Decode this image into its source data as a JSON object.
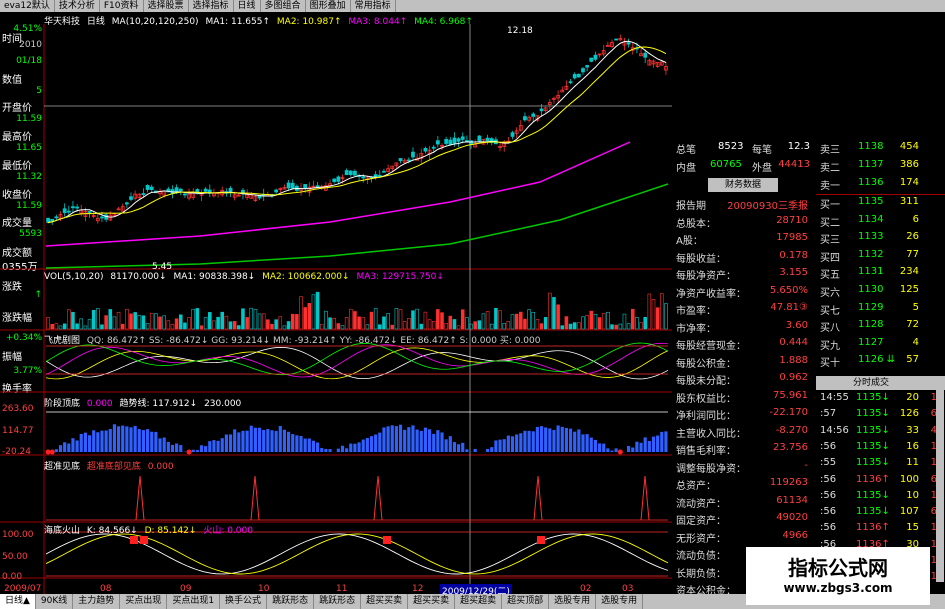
{
  "menu": [
    "eva12默认",
    "技术分析",
    "F10资料",
    "选择股票",
    "选择指标",
    "日线",
    "多图组合",
    "图形叠加",
    "常用指标"
  ],
  "main_header": {
    "stock": "华天科技",
    "period": "日线",
    "ma_params": "MA(10,20,120,250)",
    "ma1": "MA1: 11.655↑",
    "ma2": "MA2: 10.987↑",
    "ma3": "MA3: 8.044↑",
    "ma4": "MA4: 6.968↑",
    "high_mark": "12.18",
    "low_mark": "5.45"
  },
  "left_panel": {
    "labels": [
      "时间",
      "2010",
      "01/18",
      "数值",
      "5",
      "开盘价",
      "11.59",
      "最高价",
      "11.65",
      "最低价",
      "11.32",
      "收盘价",
      "11.59",
      "成交量",
      "5593",
      "成交额",
      "0355万",
      "涨跌",
      "↑",
      "涨跌幅",
      "+0.34%",
      "振幅",
      "3.77%",
      "换手率",
      "4.51%"
    ]
  },
  "vol_header": {
    "title": "VOL(5,10,20)",
    "v1": "81170.000↓",
    "ma1": "MA1: 90838.398↓",
    "ma2": "MA2: 100662.000↓",
    "ma3": "MA3: 129715.750↓"
  },
  "ind1_header": {
    "title": "飞虎剧图",
    "text": "QQ: 86.472↑ SS: -86.472↓ GG: 93.214↓ MM: -93.214↑ YY: -86.472↓ EE: 86.472↑ S: 0.000 买: 0.000"
  },
  "ind2_header": {
    "title": "阶段顶底",
    "v": "0.000",
    "trend": "趋势线: 117.912↓",
    "top": "230.000",
    "scale": [
      "263.60",
      "114.77",
      "-20.24"
    ]
  },
  "ind3_header": {
    "title": "超准见底",
    "sub": "超准底部见底",
    "v": "0.000"
  },
  "ind4_header": {
    "title": "海底火山",
    "k": "K: 84.566↓",
    "d": "D: 85.142↓",
    "huoshan": "火山: 0.000",
    "scale": [
      "100.00",
      "50.00",
      "0.00"
    ]
  },
  "date_axis": {
    "start": "2009/07",
    "labels": [
      "08",
      "09",
      "10",
      "11",
      "12",
      "02",
      "03"
    ],
    "cursor": "2009/12/29(二)"
  },
  "quote_top": [
    {
      "k": "总笔",
      "v": "8523",
      "k2": "每笔",
      "v2": "12.3"
    },
    {
      "k": "内盘",
      "v": "60765",
      "k2": "外盘",
      "v2": "44413"
    }
  ],
  "fin_title": "财务数据",
  "financials": [
    {
      "k": "报告期",
      "v": "20090930三季报"
    },
    {
      "k": "总股本：",
      "v": "28710"
    },
    {
      "k": "A股：",
      "v": "17985"
    },
    {
      "k": "每股收益：",
      "v": "0.178"
    },
    {
      "k": "每股净资产：",
      "v": "3.155"
    },
    {
      "k": "净资产收益率：",
      "v": "5.650%"
    },
    {
      "k": "市盈率：",
      "v": "47.81③"
    },
    {
      "k": "市净率：",
      "v": "3.60"
    },
    {
      "k": "每股经营现金：",
      "v": "0.444"
    },
    {
      "k": "每股公积金：",
      "v": "1.888"
    },
    {
      "k": "每股未分配：",
      "v": "0.962"
    },
    {
      "k": "股东权益比：",
      "v": "75.961"
    },
    {
      "k": "净利润同比：",
      "v": "-22.170"
    },
    {
      "k": "主营收入同比：",
      "v": "-8.270"
    },
    {
      "k": "销售毛利率：",
      "v": "23.756"
    },
    {
      "k": "调整每股净资：",
      "v": "-"
    },
    {
      "k": "总资产：",
      "v": "119263"
    },
    {
      "k": "流动资产：",
      "v": "61134"
    },
    {
      "k": "固定资产：",
      "v": "49020"
    },
    {
      "k": "无形资产：",
      "v": "4966"
    },
    {
      "k": "流动负债：",
      "v": ""
    },
    {
      "k": "长期负债：",
      "v": ""
    },
    {
      "k": "资本公积金：",
      "v": ""
    }
  ],
  "orderbook": [
    {
      "k": "卖三",
      "p": "1138",
      "q": "454"
    },
    {
      "k": "卖二",
      "p": "1137",
      "q": "386"
    },
    {
      "k": "卖一",
      "p": "1136",
      "q": "174"
    },
    {
      "k": "买一",
      "p": "1135",
      "q": "311"
    },
    {
      "k": "买二",
      "p": "1134",
      "q": "6"
    },
    {
      "k": "买三",
      "p": "1133",
      "q": "26"
    },
    {
      "k": "买四",
      "p": "1132",
      "q": "77"
    },
    {
      "k": "买五",
      "p": "1131",
      "q": "234"
    },
    {
      "k": "买六",
      "p": "1130",
      "q": "125"
    },
    {
      "k": "买七",
      "p": "1129",
      "q": "5"
    },
    {
      "k": "买八",
      "p": "1128",
      "q": "72"
    },
    {
      "k": "买九",
      "p": "1127",
      "q": "4"
    },
    {
      "k": "买十",
      "p": "1126 ⇊",
      "q": "57"
    }
  ],
  "trades_title": "分时成交",
  "trades": [
    {
      "t": "14:55",
      "p": "1135↓",
      "v": "20",
      "c": "1"
    },
    {
      "t": ":57",
      "p": "1135↓",
      "v": "126",
      "c": "6"
    },
    {
      "t": "14:56",
      "p": "1135↓",
      "v": "33",
      "c": "4"
    },
    {
      "t": ":56",
      "p": "1135↓",
      "v": "16",
      "c": "1"
    },
    {
      "t": ":55",
      "p": "1135↓",
      "v": "11",
      "c": "1"
    },
    {
      "t": ":56",
      "p": "1136↑",
      "v": "100",
      "c": "6"
    },
    {
      "t": ":56",
      "p": "1135↓",
      "v": "10",
      "c": "1"
    },
    {
      "t": ":56",
      "p": "1135↓",
      "v": "107",
      "c": "6"
    },
    {
      "t": ":56",
      "p": "1136↑",
      "v": "15",
      "c": "1"
    },
    {
      "t": ":56",
      "p": "1136↑",
      "v": "30",
      "c": "1"
    },
    {
      "t": ":56",
      "p": "1136↑",
      "v": "30",
      "c": "1"
    },
    {
      "t": ":56",
      "p": "1136↑",
      "v": "30",
      "c": "1"
    }
  ],
  "bottom_tabs": [
    "日线▲",
    "90K线",
    "主力趋势",
    "买点出现",
    "买点出现1",
    "换手公式",
    "跳跃形态",
    "跳跃形态",
    "超买买卖",
    "超买买卖",
    "超买超卖",
    "超买顶部",
    "选股专用",
    "选股专用"
  ],
  "watermark": {
    "title": "指标公式网",
    "url": "www.zbgs3.com"
  },
  "colors": {
    "up": "#ff3030",
    "down": "#00c8c8",
    "ma1": "#ffffff",
    "ma2": "#ffff00",
    "ma3": "#ff00ff",
    "ma4": "#00ff00",
    "grid": "#a00000"
  }
}
